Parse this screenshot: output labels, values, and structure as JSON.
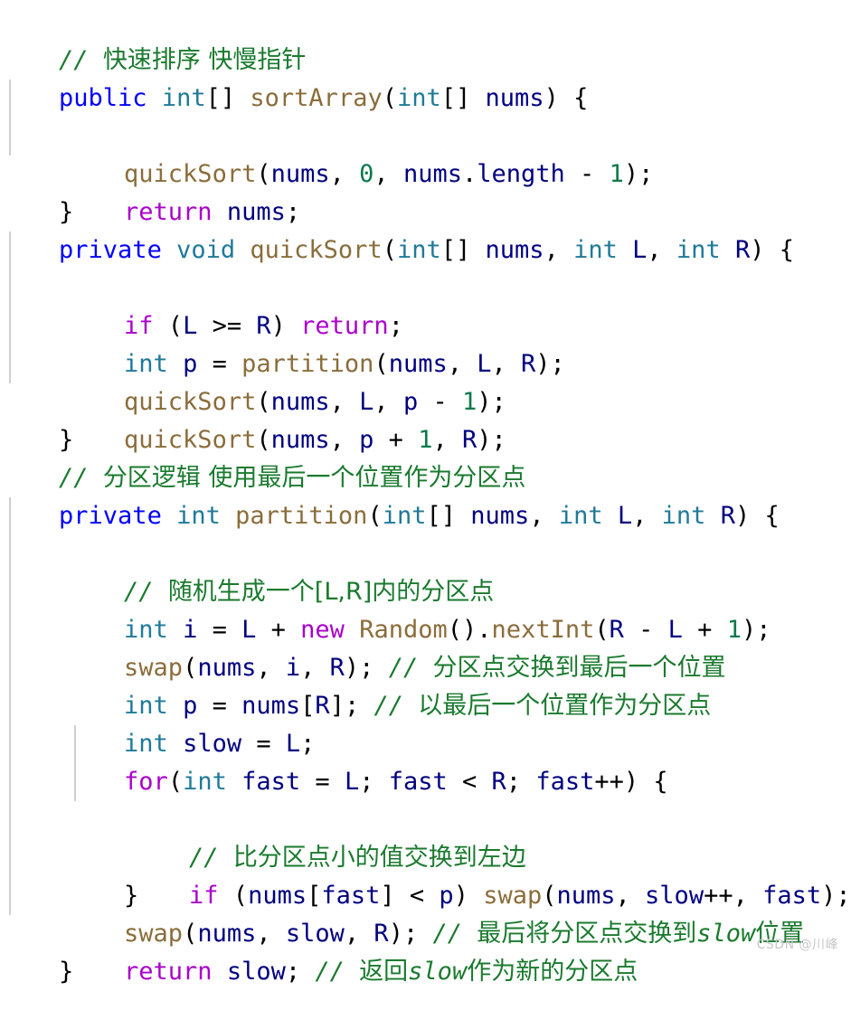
{
  "editor": {
    "language": "java",
    "colors": {
      "background": "#ffffff",
      "keyword_modifier": "#0000ff",
      "keyword_control": "#aa00cc",
      "type": "#1f7a99",
      "function": "#8a6d3b",
      "identifier": "#000080",
      "number": "#0b7a4b",
      "comment": "#1a7a2e",
      "punctuation": "#000000",
      "indent_guide": "#d0d0d0",
      "watermark": "#c8c8c8"
    },
    "lines": [
      {
        "id": "l1",
        "indent": 0,
        "guides": 0,
        "text": "// 快速排序 快慢指针"
      },
      {
        "id": "l2",
        "indent": 0,
        "guides": 0,
        "text": "public int[] sortArray(int[] nums) {"
      },
      {
        "id": "l3",
        "indent": 1,
        "guides": 1,
        "text": "quickSort(nums, 0, nums.length - 1);"
      },
      {
        "id": "l4",
        "indent": 1,
        "guides": 1,
        "text": "return nums;"
      },
      {
        "id": "l5",
        "indent": 0,
        "guides": 0,
        "text": "}"
      },
      {
        "id": "l6",
        "indent": 0,
        "guides": 0,
        "text": "private void quickSort(int[] nums, int L, int R) {"
      },
      {
        "id": "l7",
        "indent": 1,
        "guides": 1,
        "text": "if (L >= R) return;"
      },
      {
        "id": "l8",
        "indent": 1,
        "guides": 1,
        "text": "int p = partition(nums, L, R);"
      },
      {
        "id": "l9",
        "indent": 1,
        "guides": 1,
        "text": "quickSort(nums, L, p - 1);"
      },
      {
        "id": "l10",
        "indent": 1,
        "guides": 1,
        "text": "quickSort(nums, p + 1, R);"
      },
      {
        "id": "l11",
        "indent": 0,
        "guides": 0,
        "text": "}"
      },
      {
        "id": "l12",
        "indent": 0,
        "guides": 0,
        "text": "// 分区逻辑 使用最后一个位置作为分区点"
      },
      {
        "id": "l13",
        "indent": 0,
        "guides": 0,
        "text": "private int partition(int[] nums, int L, int R) {"
      },
      {
        "id": "l14",
        "indent": 1,
        "guides": 1,
        "text": "// 随机生成一个[L,R]内的分区点"
      },
      {
        "id": "l15",
        "indent": 1,
        "guides": 1,
        "text": "int i = L + new Random().nextInt(R - L + 1);"
      },
      {
        "id": "l16",
        "indent": 1,
        "guides": 1,
        "text": "swap(nums, i, R); // 分区点交换到最后一个位置"
      },
      {
        "id": "l17",
        "indent": 1,
        "guides": 1,
        "text": "int p = nums[R]; // 以最后一个位置作为分区点"
      },
      {
        "id": "l18",
        "indent": 1,
        "guides": 1,
        "text": "int slow = L;"
      },
      {
        "id": "l19",
        "indent": 1,
        "guides": 1,
        "text": "for(int fast = L; fast < R; fast++) {"
      },
      {
        "id": "l20",
        "indent": 2,
        "guides": 2,
        "text": "// 比分区点小的值交换到左边"
      },
      {
        "id": "l21",
        "indent": 2,
        "guides": 2,
        "text": "if (nums[fast] < p) swap(nums, slow++, fast);"
      },
      {
        "id": "l22",
        "indent": 1,
        "guides": 1,
        "text": "}"
      },
      {
        "id": "l23",
        "indent": 1,
        "guides": 1,
        "text": "swap(nums, slow, R); // 最后将分区点交换到slow位置"
      },
      {
        "id": "l24",
        "indent": 1,
        "guides": 1,
        "text": "return slow; // 返回slow作为新的分区点"
      },
      {
        "id": "l25",
        "indent": 0,
        "guides": 0,
        "text": "}"
      }
    ]
  },
  "watermark": {
    "text": "CSDN @川峰"
  }
}
